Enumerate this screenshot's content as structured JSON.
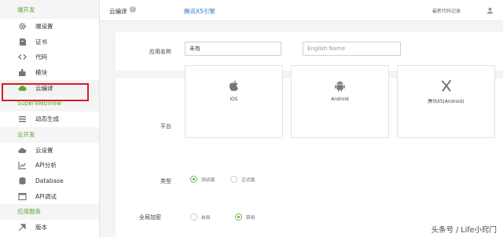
{
  "sidebar": {
    "sections": [
      {
        "title": "端开发",
        "items": [
          {
            "label": "端设置",
            "icon": "gear-icon"
          },
          {
            "label": "证书",
            "icon": "certificate-icon"
          },
          {
            "label": "代码",
            "icon": "code-icon"
          },
          {
            "label": "模块",
            "icon": "puzzle-icon"
          },
          {
            "label": "云编译",
            "icon": "cloud-icon",
            "active": true
          }
        ]
      },
      {
        "title": "SuperWebView",
        "items": [
          {
            "label": "动态生成",
            "icon": "list-icon"
          }
        ]
      },
      {
        "title": "云开发",
        "items": [
          {
            "label": "云设置",
            "icon": "cloud-settings-icon"
          },
          {
            "label": "API分析",
            "icon": "chart-icon"
          },
          {
            "label": "Database",
            "icon": "database-icon"
          },
          {
            "label": "API调试",
            "icon": "api-debug-icon"
          }
        ]
      },
      {
        "title": "应用服务",
        "items": [
          {
            "label": "版本",
            "icon": "version-icon"
          }
        ]
      }
    ]
  },
  "topbar": {
    "title": "云编译",
    "help": "?",
    "engine_link": "腾讯X5引擎",
    "records_link": "最新代码记录"
  },
  "form": {
    "app_name_label": "应用名称",
    "app_name_value": "未有",
    "english_placeholder": "English Name",
    "platform_label": "平台",
    "platforms": [
      {
        "label": "iOS",
        "icon": "apple-icon"
      },
      {
        "label": "Android",
        "icon": "android-icon"
      },
      {
        "label": "腾讯X5(Android)",
        "icon": "x5-icon"
      }
    ],
    "type_label": "类型",
    "type_options": [
      {
        "label": "测试版",
        "checked": true
      },
      {
        "label": "正式版",
        "checked": false
      }
    ],
    "encrypt_label": "全局加密",
    "encrypt_options": [
      {
        "label": "启用",
        "checked": false
      },
      {
        "label": "禁用",
        "checked": true
      }
    ]
  },
  "watermark": "头条号 / Life小窍门",
  "colors": {
    "accent_green": "#5aa833",
    "link_blue": "#2f7bd4",
    "highlight_red": "#cf2027"
  }
}
